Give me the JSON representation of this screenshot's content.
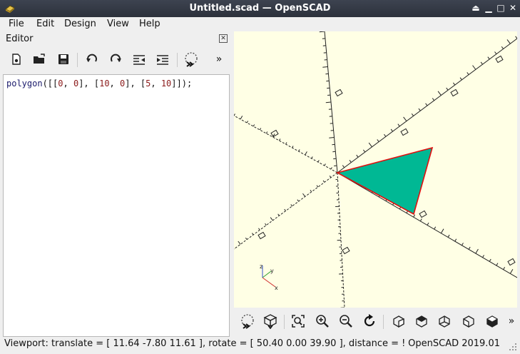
{
  "window": {
    "title": "Untitled.scad — OpenSCAD",
    "controls": [
      "eject-icon",
      "minimize-icon",
      "maximize-icon",
      "close-icon"
    ]
  },
  "menubar": {
    "items": [
      {
        "label": "File"
      },
      {
        "label": "Edit"
      },
      {
        "label": "Design"
      },
      {
        "label": "View"
      },
      {
        "label": "Help"
      }
    ]
  },
  "editor": {
    "label": "Editor",
    "toolbar_icons": [
      "new-file-icon",
      "open-file-icon",
      "save-icon",
      "undo-icon",
      "redo-icon",
      "unindent-icon",
      "indent-icon",
      "preview-icon",
      "overflow-icon"
    ],
    "code": {
      "func": "polygon",
      "open": "([[",
      "p1a": "0",
      "c1": ", ",
      "p1b": "0",
      "s1": "], [",
      "p2a": "10",
      "c2": ", ",
      "p2b": "0",
      "s2": "], [",
      "p3a": "5",
      "c3": ", ",
      "p3b": "10",
      "close": "]]);"
    }
  },
  "viewport": {
    "background": "#ffffe5",
    "shape_fill": "#00b894",
    "shape_edge": "#e01010",
    "axis_x_label": "x",
    "axis_y_label": "y",
    "axis_z_label": "z"
  },
  "viewport_toolbar": {
    "icons": [
      "preview-icon",
      "render-icon",
      "view-all-icon",
      "zoom-in-icon",
      "zoom-out-icon",
      "reset-view-icon",
      "view-right-icon",
      "view-top-icon",
      "view-bottom-icon",
      "view-left-icon",
      "view-front-icon",
      "overflow-icon"
    ]
  },
  "status": {
    "viewport": "Viewport: translate = [ 11.64 -7.80 11.61 ], rotate = [ 50.40 0.00 39.90 ], distance = !",
    "version": "OpenSCAD 2019.01"
  }
}
